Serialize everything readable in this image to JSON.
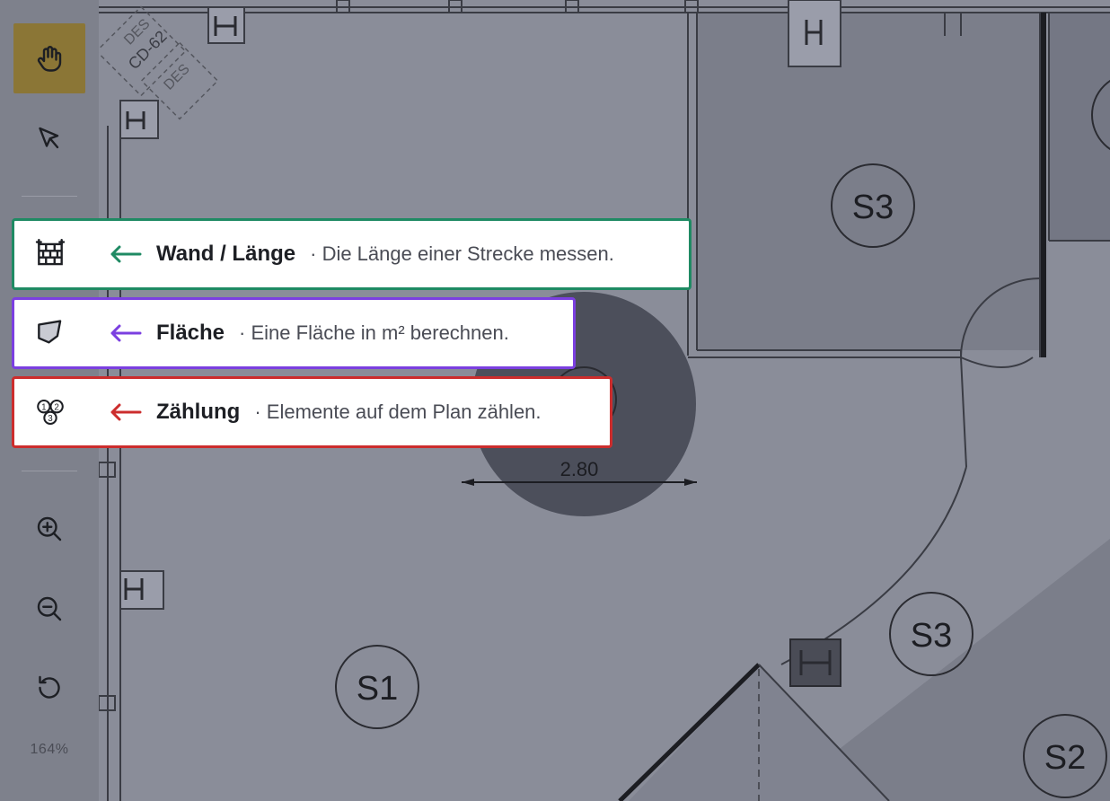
{
  "plan": {
    "rooms": [
      {
        "label": "S3"
      },
      {
        "label": "S3"
      },
      {
        "label": "S1"
      },
      {
        "label": "S2"
      }
    ],
    "dimension": "2.80",
    "markers": [
      {
        "label": "DES"
      },
      {
        "label": "CD-62"
      },
      {
        "label": "DES"
      }
    ]
  },
  "toolbar": {
    "tools": [
      {
        "name": "pan",
        "icon": "hand-icon",
        "active": true
      },
      {
        "name": "select",
        "icon": "cursor-arrow-icon",
        "active": false
      },
      {
        "name": "wall-length",
        "icon": "brick-wall-icon",
        "active": false
      },
      {
        "name": "area",
        "icon": "polygon-icon",
        "active": false
      },
      {
        "name": "count",
        "icon": "numbered-circles-icon",
        "active": false
      },
      {
        "name": "zoom-in",
        "icon": "zoom-in-icon",
        "active": false
      },
      {
        "name": "zoom-out",
        "icon": "zoom-out-icon",
        "active": false
      },
      {
        "name": "reset",
        "icon": "rotate-ccw-icon",
        "active": false
      }
    ],
    "zoom_level": "164%"
  },
  "callouts": [
    {
      "title": "Wand / Länge",
      "desc": "Die Länge einer Strecke messen.",
      "color": "#1f8a63"
    },
    {
      "title": "Fläche",
      "desc": "Eine Fläche in m² berechnen.",
      "color": "#7b3fe0"
    },
    {
      "title": "Zählung",
      "desc": "Elemente auf dem Plan zählen.",
      "color": "#cc2d2d"
    }
  ],
  "colors": {
    "active_tool": "#8b7636",
    "overlay": "#8a8d99"
  }
}
